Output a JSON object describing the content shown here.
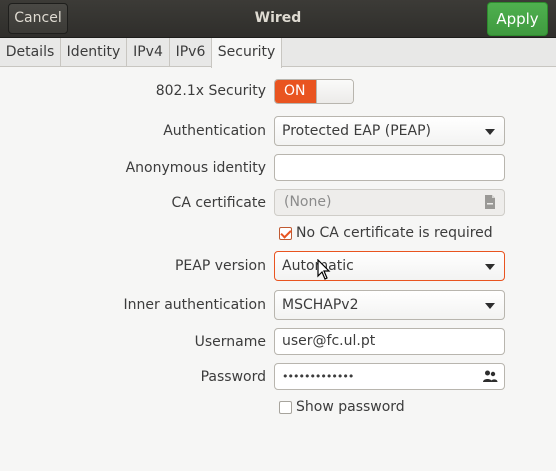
{
  "window": {
    "title": "Wired"
  },
  "header": {
    "cancel_label": "Cancel",
    "apply_label": "Apply"
  },
  "tabs": [
    {
      "label": "Details"
    },
    {
      "label": "Identity"
    },
    {
      "label": "IPv4"
    },
    {
      "label": "IPv6"
    },
    {
      "label": "Security",
      "active": true
    }
  ],
  "form": {
    "security_label": "802.1x Security",
    "security_toggle": "ON",
    "authentication_label": "Authentication",
    "authentication_value": "Protected EAP (PEAP)",
    "anonymous_identity_label": "Anonymous identity",
    "anonymous_identity_value": "",
    "ca_certificate_label": "CA certificate",
    "ca_certificate_value": "(None)",
    "no_ca_label": "No CA certificate is required",
    "no_ca_checked": true,
    "peap_version_label": "PEAP version",
    "peap_version_value": "Automatic",
    "inner_auth_label": "Inner authentication",
    "inner_auth_value": "MSCHAPv2",
    "username_label": "Username",
    "username_value": "user@fc.ul.pt",
    "password_label": "Password",
    "password_value": "•••••••••••••",
    "show_password_label": "Show password",
    "show_password_checked": false
  },
  "colors": {
    "accent": "#e95420",
    "apply_green": "#43a143",
    "titlebar": "#3c3b37"
  },
  "icons": {
    "certificate_picker": "file-icon",
    "password_storage": "users-icon",
    "pointer": "mouse-cursor-icon"
  }
}
